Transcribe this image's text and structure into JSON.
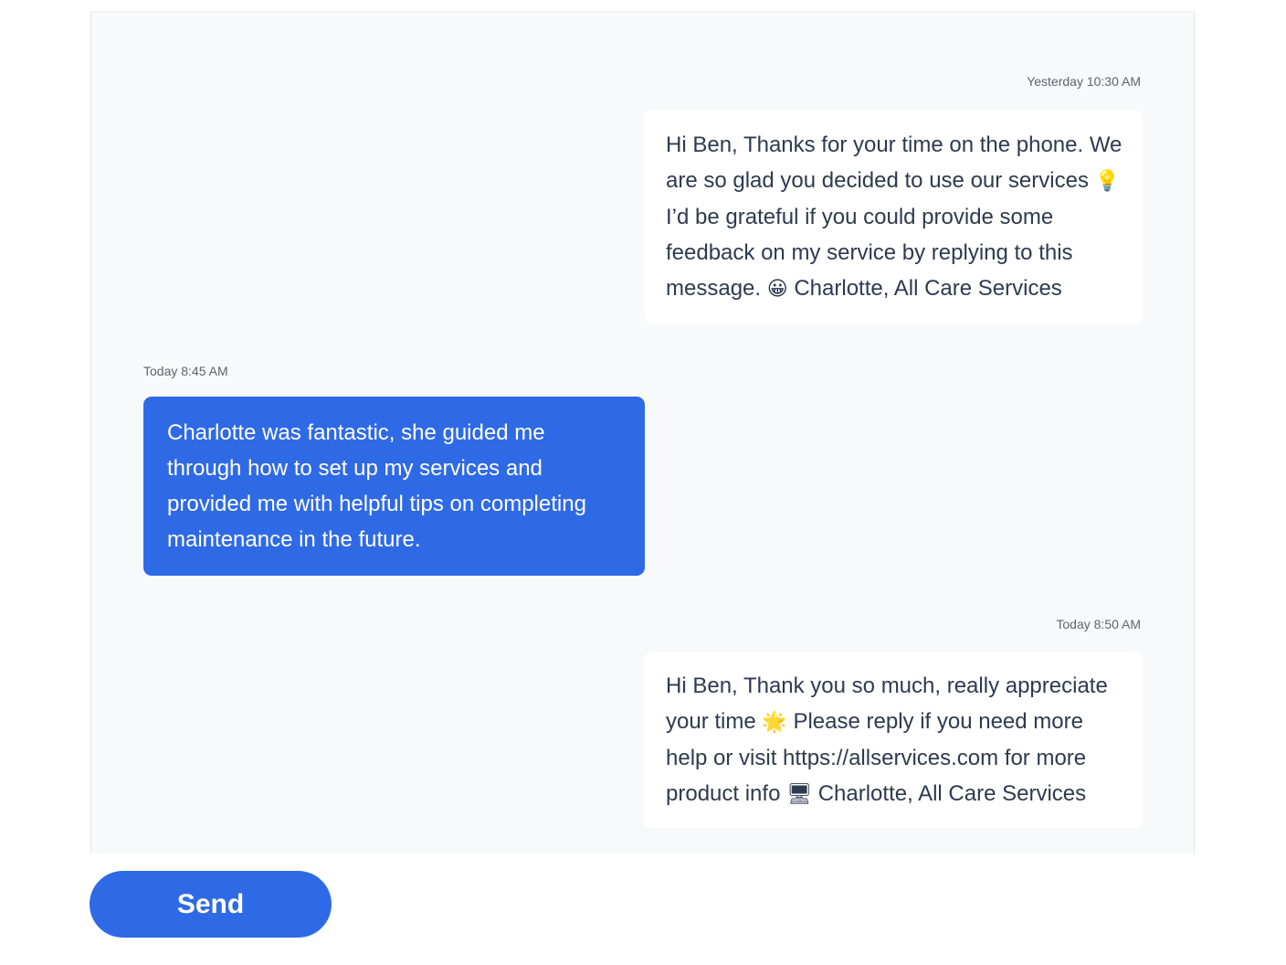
{
  "messages": [
    {
      "direction": "incoming",
      "timestamp": "Yesterday 10:30 AM",
      "text_part1": "Hi Ben, Thanks for your time on the phone. We are so glad you decided to use our services",
      "emoji1": "💡",
      "text_part2": " I’d be grateful if you could provide some feedback on my service by replying to this message.",
      "emoji2": "😀",
      "text_part3": " Charlotte, All Care Services"
    },
    {
      "direction": "outgoing",
      "timestamp": "Today 8:45 AM",
      "text": "Charlotte was fantastic, she guided me through how to set up my services and provided me with helpful tips on completing maintenance in the future."
    },
    {
      "direction": "incoming",
      "timestamp": "Today 8:50 AM",
      "text_part1": "Hi Ben, Thank you so much, really appreciate your time",
      "emoji1": "🌟",
      "text_part2": " Please reply if you need more help or visit https://allservices.com for more product info",
      "emoji2": "🖥",
      "text_part3": " Charlotte, All Care Services"
    }
  ],
  "composer": {
    "send_label": "Send"
  },
  "colors": {
    "accent": "#2f6ae6",
    "panel_background": "#f8f9fb",
    "incoming_bubble": "#ffffff",
    "incoming_text": "#2e3a4f",
    "timestamp_text": "#5c6470"
  },
  "icons": {
    "message1_emoji1": "lightbulb-icon",
    "message1_emoji2": "grinning-face-icon",
    "message3_emoji1": "sparkle-star-icon",
    "message3_emoji2": "desktop-computer-icon"
  }
}
